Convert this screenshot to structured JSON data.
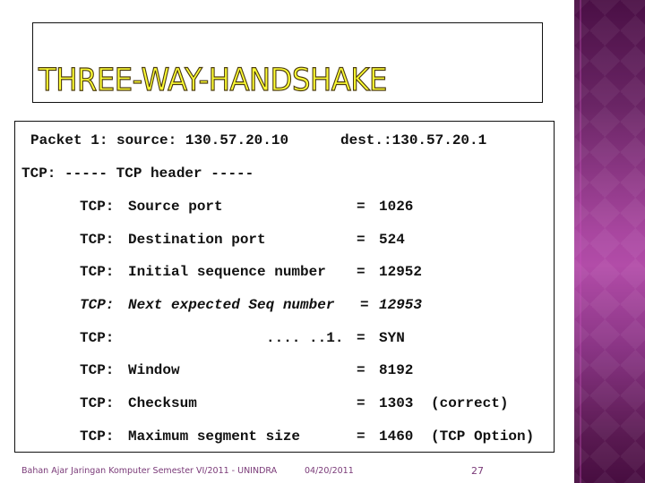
{
  "slide": {
    "title": "THREE-WAY-HANDSHAKE",
    "colors": {
      "title_fill": "#ffff33",
      "title_outline": "#4a3a10",
      "footer_text": "#7a3a78",
      "panel_purple": "#a8469f"
    },
    "packet_line": {
      "label": "Packet 1:",
      "source_label": "source:",
      "source_ip": "130.57.20.10",
      "dest_label": "dest.:",
      "dest_ip": "130.57.20.1"
    },
    "header_line": "TCP: ----- TCP header -----",
    "fields": [
      {
        "prefix": "TCP:",
        "name": "Source port",
        "eq": "=",
        "value": "1026",
        "note": ""
      },
      {
        "prefix": "TCP:",
        "name": "Destination port",
        "eq": "=",
        "value": "524",
        "note": ""
      },
      {
        "prefix": "TCP:",
        "name": "Initial sequence number",
        "eq": "=",
        "value": "12952",
        "note": ""
      },
      {
        "prefix": "TCP:",
        "name": "Next expected Seq number",
        "eq": "=",
        "value": "12953",
        "note": ""
      },
      {
        "prefix": "TCP:",
        "name": ".... ..1.",
        "eq": "=",
        "value": "SYN",
        "note": ""
      },
      {
        "prefix": "TCP:",
        "name": "Window",
        "eq": "=",
        "value": "8192",
        "note": ""
      },
      {
        "prefix": "TCP:",
        "name": "Checksum",
        "eq": "=",
        "value": "1303",
        "note": "(correct)"
      },
      {
        "prefix": "TCP:",
        "name": "Maximum segment size",
        "eq": "=",
        "value": "1460",
        "note": "(TCP Option)"
      }
    ],
    "footer": {
      "course": "Bahan Ajar Jaringan Komputer Semester VI/2011 - UNINDRA",
      "date": "04/20/2011",
      "page_number": "27"
    }
  }
}
